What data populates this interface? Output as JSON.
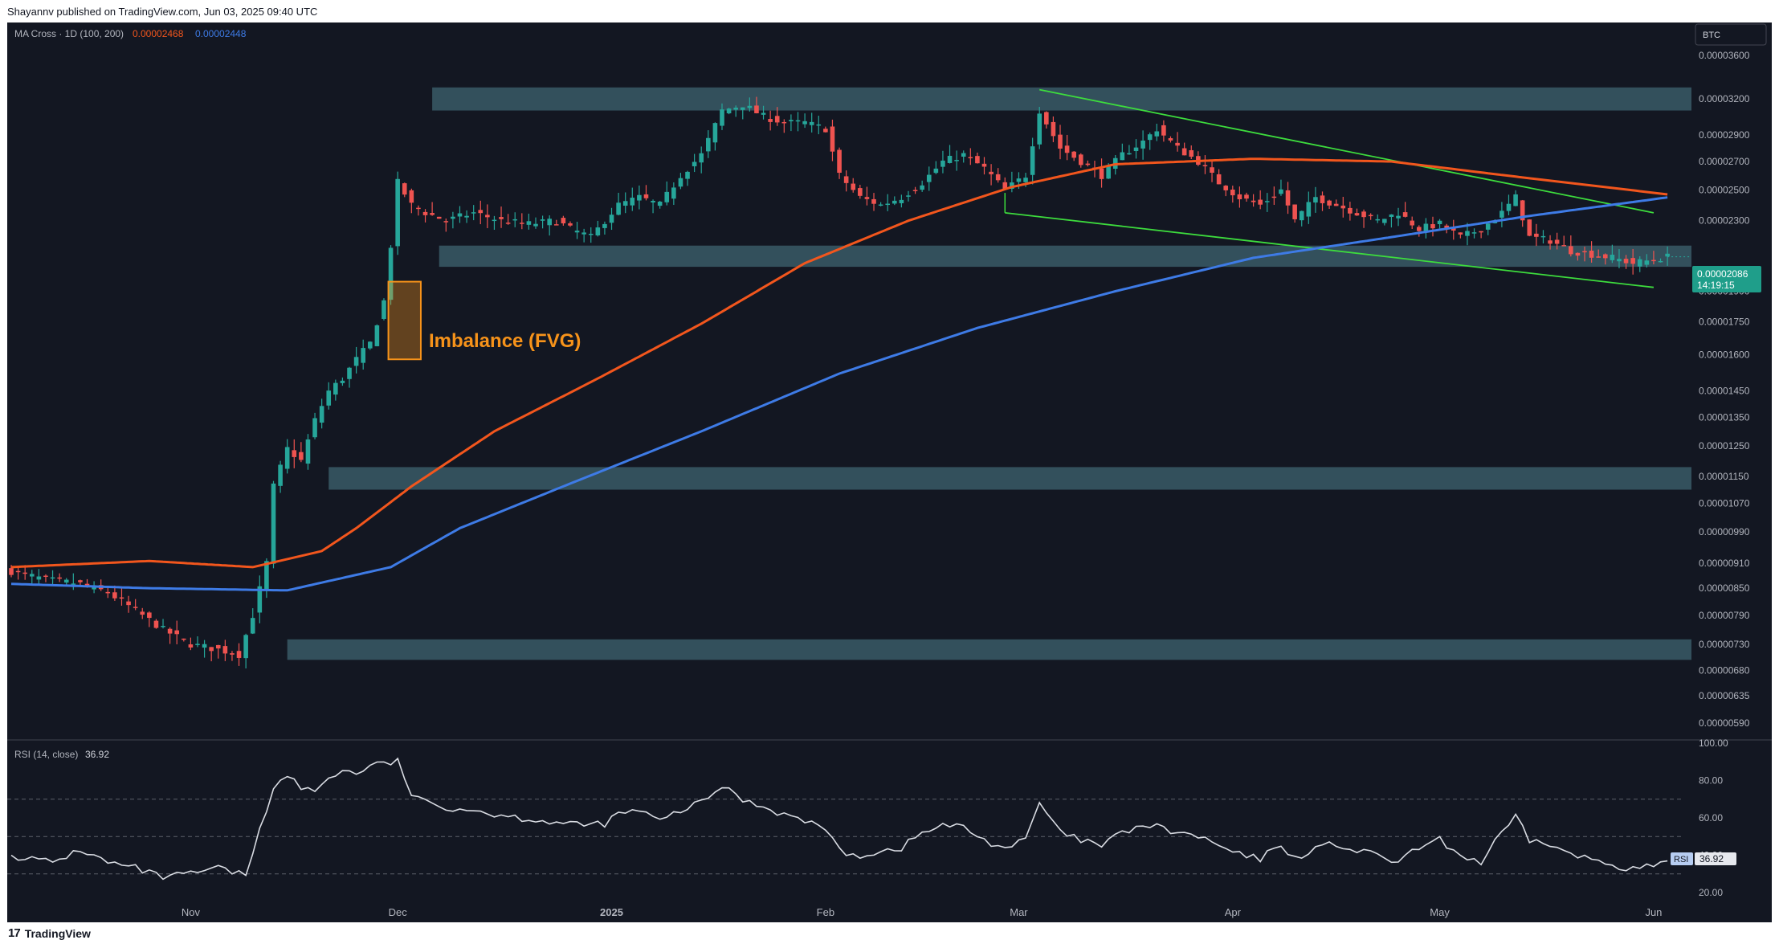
{
  "header": {
    "published": "Shayannv published on TradingView.com, Jun 03, 2025 09:40 UTC"
  },
  "footer": {
    "brand": "TradingView"
  },
  "symbol_badge": "BTC",
  "indicator_legend": {
    "name": "MA Cross · 1D (100, 200)",
    "ma100_value": "0.00002468",
    "ma200_value": "0.00002448"
  },
  "rsi_legend": {
    "name": "RSI (14, close)",
    "value": "36.92",
    "tag_label": "RSI"
  },
  "price_tag": {
    "price": "0.00002086",
    "countdown": "14:19:15"
  },
  "annotation": {
    "label": "Imbalance (FVG)"
  },
  "colors": {
    "background": "#131722",
    "up": "#26a69a",
    "down": "#ef5350",
    "ma100": "#f2561d",
    "ma200": "#3e7be6",
    "zone": "#3a5a66",
    "channel": "#3ddc3d",
    "fvg": "#f7931a",
    "rsi_line": "#d9dce3",
    "text": "#b2b5be"
  },
  "chart_data": [
    {
      "type": "line",
      "subtype": "candlestick",
      "pair": "BTC",
      "timeframe": "1D",
      "scale": "log",
      "ylim": [
        5.6e-06,
        3.8e-06
      ],
      "x_tick_labels": [
        "Nov",
        "Dec",
        "2025",
        "Feb",
        "Mar",
        "Apr",
        "May",
        "Jun"
      ],
      "y_tick_labels": [
        "0.00003600",
        "0.00003200",
        "0.00002900",
        "0.00002700",
        "0.00002500",
        "0.00002300",
        "0.00001900",
        "0.00001750",
        "0.00001600",
        "0.00001450",
        "0.00001350",
        "0.00001250",
        "0.00001150",
        "0.00001070",
        "0.00000990",
        "0.00000910",
        "0.00000850",
        "0.00000790",
        "0.00000730",
        "0.00000680",
        "0.00000635",
        "0.00000590"
      ],
      "y_ticks": [
        3.6e-05,
        3.2e-05,
        2.9e-05,
        2.7e-05,
        2.5e-05,
        2.3e-05,
        1.9e-05,
        1.75e-05,
        1.6e-05,
        1.45e-05,
        1.35e-05,
        1.25e-05,
        1.15e-05,
        1.07e-05,
        9.9e-06,
        9.1e-06,
        8.5e-06,
        7.9e-06,
        7.3e-06,
        6.8e-06,
        6.35e-06,
        5.9e-06
      ],
      "x_tick_days": [
        26,
        56,
        87,
        118,
        146,
        177,
        207,
        238
      ],
      "close_anchors": [
        [
          0,
          8.9e-06
        ],
        [
          5,
          8.7e-06
        ],
        [
          10,
          8.6e-06
        ],
        [
          14,
          8.4e-06
        ],
        [
          18,
          8e-06
        ],
        [
          22,
          7.6e-06
        ],
        [
          26,
          7.3e-06
        ],
        [
          30,
          7.2e-06
        ],
        [
          33,
          7.1e-06
        ],
        [
          35,
          7.9e-06
        ],
        [
          37,
          9.1e-06
        ],
        [
          38,
          1.12e-05
        ],
        [
          40,
          1.24e-05
        ],
        [
          42,
          1.2e-05
        ],
        [
          44,
          1.34e-05
        ],
        [
          46,
          1.45e-05
        ],
        [
          48,
          1.5e-05
        ],
        [
          50,
          1.58e-05
        ],
        [
          52,
          1.65e-05
        ],
        [
          54,
          1.85e-05
        ],
        [
          55,
          2.15e-05
        ],
        [
          56,
          2.55e-05
        ],
        [
          58,
          2.4e-05
        ],
        [
          60,
          2.35e-05
        ],
        [
          63,
          2.3e-05
        ],
        [
          67,
          2.35e-05
        ],
        [
          71,
          2.3e-05
        ],
        [
          75,
          2.28e-05
        ],
        [
          79,
          2.3e-05
        ],
        [
          81,
          2.25e-05
        ],
        [
          84,
          2.2e-05
        ],
        [
          86,
          2.3e-05
        ],
        [
          88,
          2.4e-05
        ],
        [
          91,
          2.45e-05
        ],
        [
          94,
          2.4e-05
        ],
        [
          97,
          2.6e-05
        ],
        [
          100,
          2.75e-05
        ],
        [
          103,
          3.1e-05
        ],
        [
          106,
          3.15e-05
        ],
        [
          109,
          3.05e-05
        ],
        [
          112,
          3e-05
        ],
        [
          115,
          3e-05
        ],
        [
          118,
          2.95e-05
        ],
        [
          120,
          2.6e-05
        ],
        [
          123,
          2.45e-05
        ],
        [
          126,
          2.4e-05
        ],
        [
          129,
          2.45e-05
        ],
        [
          132,
          2.55e-05
        ],
        [
          135,
          2.7e-05
        ],
        [
          138,
          2.75e-05
        ],
        [
          141,
          2.65e-05
        ],
        [
          144,
          2.5e-05
        ],
        [
          147,
          2.6e-05
        ],
        [
          149,
          3.1e-05
        ],
        [
          152,
          2.8e-05
        ],
        [
          155,
          2.7e-05
        ],
        [
          158,
          2.6e-05
        ],
        [
          161,
          2.75e-05
        ],
        [
          164,
          2.85e-05
        ],
        [
          166,
          2.95e-05
        ],
        [
          169,
          2.8e-05
        ],
        [
          172,
          2.7e-05
        ],
        [
          175,
          2.55e-05
        ],
        [
          178,
          2.45e-05
        ],
        [
          181,
          2.4e-05
        ],
        [
          184,
          2.5e-05
        ],
        [
          186,
          2.3e-05
        ],
        [
          189,
          2.45e-05
        ],
        [
          192,
          2.4e-05
        ],
        [
          195,
          2.35e-05
        ],
        [
          198,
          2.3e-05
        ],
        [
          201,
          2.35e-05
        ],
        [
          204,
          2.25e-05
        ],
        [
          207,
          2.28e-05
        ],
        [
          210,
          2.2e-05
        ],
        [
          213,
          2.25e-05
        ],
        [
          216,
          2.35e-05
        ],
        [
          218,
          2.45e-05
        ],
        [
          220,
          2.2e-05
        ],
        [
          223,
          2.18e-05
        ],
        [
          226,
          2.12e-05
        ],
        [
          229,
          2.1e-05
        ],
        [
          232,
          2.08e-05
        ],
        [
          235,
          2.05e-05
        ],
        [
          238,
          2.07e-05
        ],
        [
          240,
          2.086e-05
        ]
      ],
      "ma100_anchors": [
        [
          0,
          9e-06
        ],
        [
          20,
          9.15e-06
        ],
        [
          35,
          9e-06
        ],
        [
          45,
          9.4e-06
        ],
        [
          50,
          1e-05
        ],
        [
          58,
          1.12e-05
        ],
        [
          70,
          1.3e-05
        ],
        [
          85,
          1.5e-05
        ],
        [
          100,
          1.74e-05
        ],
        [
          115,
          2.05e-05
        ],
        [
          130,
          2.3e-05
        ],
        [
          145,
          2.52e-05
        ],
        [
          160,
          2.68e-05
        ],
        [
          180,
          2.72e-05
        ],
        [
          200,
          2.7e-05
        ],
        [
          220,
          2.58e-05
        ],
        [
          240,
          2.47e-05
        ]
      ],
      "ma200_anchors": [
        [
          0,
          8.6e-06
        ],
        [
          20,
          8.5e-06
        ],
        [
          40,
          8.45e-06
        ],
        [
          55,
          9e-06
        ],
        [
          65,
          1e-05
        ],
        [
          80,
          1.12e-05
        ],
        [
          100,
          1.3e-05
        ],
        [
          120,
          1.52e-05
        ],
        [
          140,
          1.72e-05
        ],
        [
          160,
          1.9e-05
        ],
        [
          180,
          2.08e-05
        ],
        [
          200,
          2.2e-05
        ],
        [
          220,
          2.33e-05
        ],
        [
          240,
          2.45e-05
        ]
      ],
      "ma100_legend": "0.00002468",
      "ma200_legend": "0.00002448",
      "zones": [
        {
          "from": 3.1e-05,
          "to": 3.3e-05,
          "start_day": 61
        },
        {
          "from": 2.03e-05,
          "to": 2.15e-05,
          "start_day": 62
        },
        {
          "from": 1.11e-05,
          "to": 1.18e-05,
          "start_day": 46
        },
        {
          "from": 7e-06,
          "to": 7.4e-06,
          "start_day": 40
        }
      ],
      "imbalance_box": {
        "from": 1.58e-05,
        "to": 1.95e-05,
        "start_day": 55,
        "end_day": 59
      },
      "channel_lines": [
        {
          "p1": [
            149,
            3.28e-05
          ],
          "p2": [
            238,
            2.35e-05
          ]
        },
        {
          "p1": [
            144,
            2.35e-05
          ],
          "p2": [
            238,
            1.92e-05
          ]
        }
      ],
      "last_price": 2.086e-05
    },
    {
      "type": "line",
      "title": "RSI (14, close)",
      "ylim": [
        15,
        100
      ],
      "y_tick_labels": [
        "100.00",
        "80.00",
        "60.00",
        "40.00",
        "20.00"
      ],
      "y_ticks": [
        100,
        80,
        60,
        40,
        20
      ],
      "reference_lines": [
        70,
        50,
        30
      ],
      "anchors": [
        [
          0,
          40
        ],
        [
          6,
          36
        ],
        [
          10,
          43
        ],
        [
          14,
          36
        ],
        [
          18,
          33
        ],
        [
          22,
          28
        ],
        [
          26,
          30
        ],
        [
          30,
          33
        ],
        [
          34,
          29
        ],
        [
          36,
          55
        ],
        [
          38,
          75
        ],
        [
          40,
          83
        ],
        [
          42,
          76
        ],
        [
          44,
          74
        ],
        [
          46,
          82
        ],
        [
          48,
          85
        ],
        [
          50,
          84
        ],
        [
          52,
          88
        ],
        [
          54,
          89
        ],
        [
          56,
          90
        ],
        [
          58,
          73
        ],
        [
          60,
          68
        ],
        [
          62,
          66
        ],
        [
          66,
          65
        ],
        [
          70,
          62
        ],
        [
          74,
          60
        ],
        [
          78,
          58
        ],
        [
          82,
          56
        ],
        [
          86,
          57
        ],
        [
          88,
          62
        ],
        [
          91,
          64
        ],
        [
          94,
          58
        ],
        [
          97,
          64
        ],
        [
          100,
          68
        ],
        [
          103,
          77
        ],
        [
          106,
          70
        ],
        [
          109,
          66
        ],
        [
          112,
          62
        ],
        [
          115,
          58
        ],
        [
          118,
          55
        ],
        [
          120,
          42
        ],
        [
          123,
          40
        ],
        [
          126,
          42
        ],
        [
          129,
          44
        ],
        [
          132,
          52
        ],
        [
          135,
          56
        ],
        [
          138,
          55
        ],
        [
          141,
          48
        ],
        [
          144,
          44
        ],
        [
          147,
          48
        ],
        [
          149,
          68
        ],
        [
          152,
          52
        ],
        [
          155,
          48
        ],
        [
          158,
          45
        ],
        [
          161,
          52
        ],
        [
          164,
          56
        ],
        [
          166,
          55
        ],
        [
          169,
          52
        ],
        [
          172,
          50
        ],
        [
          175,
          45
        ],
        [
          178,
          40
        ],
        [
          181,
          38
        ],
        [
          184,
          46
        ],
        [
          186,
          38
        ],
        [
          189,
          44
        ],
        [
          192,
          46
        ],
        [
          195,
          42
        ],
        [
          198,
          40
        ],
        [
          201,
          36
        ],
        [
          204,
          44
        ],
        [
          207,
          48
        ],
        [
          210,
          40
        ],
        [
          213,
          36
        ],
        [
          216,
          52
        ],
        [
          218,
          60
        ],
        [
          220,
          48
        ],
        [
          223,
          46
        ],
        [
          226,
          40
        ],
        [
          229,
          38
        ],
        [
          232,
          35
        ],
        [
          235,
          33
        ],
        [
          238,
          34
        ],
        [
          240,
          36.92
        ]
      ],
      "last_value": 36.92
    }
  ]
}
